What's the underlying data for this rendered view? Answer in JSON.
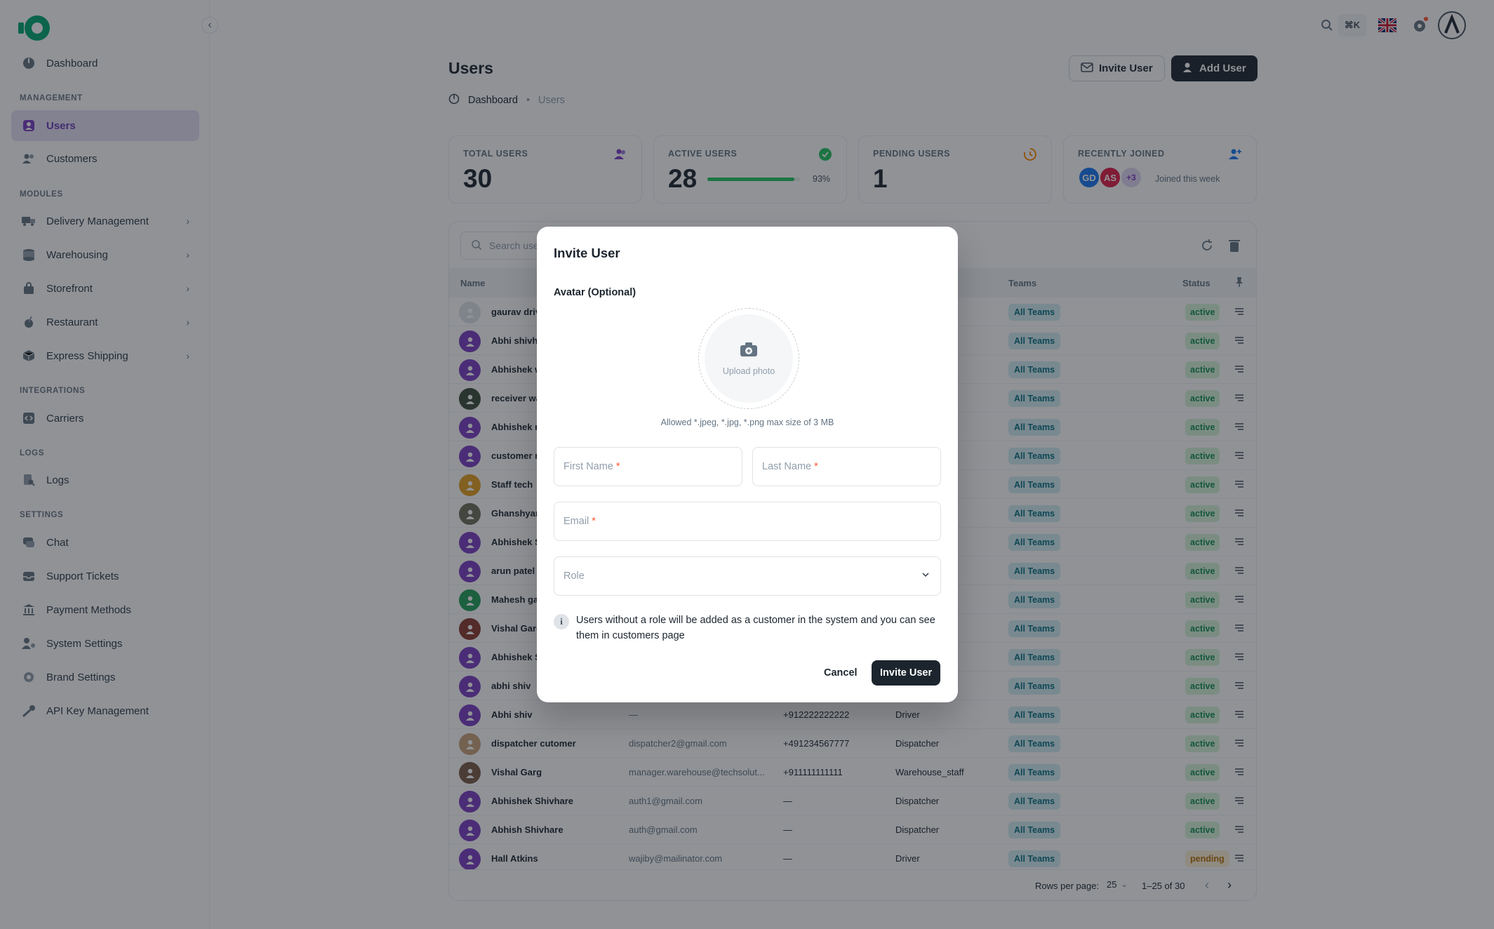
{
  "sidebar": {
    "collapse_icon": "chevron-left-icon",
    "items": {
      "dashboard": "Dashboard",
      "users": "Users",
      "customers": "Customers",
      "delivery": "Delivery Management",
      "warehousing": "Warehousing",
      "storefront": "Storefront",
      "restaurant": "Restaurant",
      "express": "Express Shipping",
      "carriers": "Carriers",
      "logs": "Logs",
      "chat": "Chat",
      "support": "Support Tickets",
      "payment": "Payment Methods",
      "system": "System Settings",
      "brand": "Brand Settings",
      "apikey": "API Key Management"
    },
    "sections": {
      "management": "MANAGEMENT",
      "modules": "MODULES",
      "integrations": "INTEGRATIONS",
      "logs": "LOGS",
      "settings": "SETTINGS"
    }
  },
  "topbar": {
    "shortcut": "⌘K"
  },
  "page": {
    "title": "Users",
    "invite_button": "Invite User",
    "add_button": "Add User",
    "breadcrumb": {
      "root": "Dashboard",
      "current": "Users"
    }
  },
  "stats": {
    "total": {
      "label": "TOTAL USERS",
      "value": "30"
    },
    "active": {
      "label": "ACTIVE USERS",
      "value": "28",
      "percent_text": "93%",
      "percent": 93
    },
    "pending": {
      "label": "PENDING USERS",
      "value": "1"
    },
    "recent": {
      "label": "RECENTLY JOINED",
      "avatars": [
        "GD",
        "AS",
        "+3"
      ],
      "note": "Joined this week"
    }
  },
  "table": {
    "search_placeholder": "Search users...",
    "headers": {
      "name": "Name",
      "teams": "Teams",
      "status": "Status"
    },
    "rows": [
      {
        "name": "gaurav driver",
        "email": "",
        "phone": "",
        "role": "",
        "team": "All Teams",
        "status": "active"
      },
      {
        "name": "Abhi shivhare",
        "email": "",
        "phone": "",
        "role": "",
        "team": "All Teams",
        "status": "active"
      },
      {
        "name": "Abhishek warehouse",
        "email": "",
        "phone": "",
        "role": "",
        "team": "All Teams",
        "status": "active"
      },
      {
        "name": "receiver warehouse",
        "email": "",
        "phone": "",
        "role": "",
        "team": "All Teams",
        "status": "active"
      },
      {
        "name": "Abhishek new",
        "email": "",
        "phone": "",
        "role": "",
        "team": "All Teams",
        "status": "active"
      },
      {
        "name": "customer new",
        "email": "",
        "phone": "",
        "role": "",
        "team": "All Teams",
        "status": "active"
      },
      {
        "name": "Staff tech",
        "email": "",
        "phone": "",
        "role": "",
        "team": "All Teams",
        "status": "active"
      },
      {
        "name": "Ghanshyam",
        "email": "",
        "phone": "",
        "role": "",
        "team": "All Teams",
        "status": "active"
      },
      {
        "name": "Abhishek Shivhare",
        "email": "",
        "phone": "",
        "role": "",
        "team": "All Teams",
        "status": "active"
      },
      {
        "name": "arun patel",
        "email": "",
        "phone": "",
        "role": "",
        "team": "All Teams",
        "status": "active"
      },
      {
        "name": "Mahesh gaur",
        "email": "",
        "phone": "",
        "role": "",
        "team": "All Teams",
        "status": "active"
      },
      {
        "name": "Vishal Garg",
        "email": "",
        "phone": "",
        "role": "",
        "team": "All Teams",
        "status": "active"
      },
      {
        "name": "Abhishek Shivhare",
        "email": "",
        "phone": "",
        "role": "",
        "team": "All Teams",
        "status": "active"
      },
      {
        "name": "abhi shiv",
        "email": "",
        "phone": "",
        "role": "",
        "team": "All Teams",
        "status": "active"
      },
      {
        "name": "Abhi shiv",
        "email": "—",
        "phone": "+912222222222",
        "role": "Driver",
        "team": "All Teams",
        "status": "active"
      },
      {
        "name": "dispatcher cutomer",
        "email": "dispatcher2@gmail.com",
        "phone": "+491234567777",
        "role": "Dispatcher",
        "team": "All Teams",
        "status": "active"
      },
      {
        "name": "Vishal Garg",
        "email": "manager.warehouse@techsolut...",
        "phone": "+911111111111",
        "role": "Warehouse_staff",
        "team": "All Teams",
        "status": "active"
      },
      {
        "name": "Abhishek Shivhare",
        "email": "auth1@gmail.com",
        "phone": "—",
        "role": "Dispatcher",
        "team": "All Teams",
        "status": "active"
      },
      {
        "name": "Abhish Shivhare",
        "email": "auth@gmail.com",
        "phone": "—",
        "role": "Dispatcher",
        "team": "All Teams",
        "status": "active"
      },
      {
        "name": "Hall Atkins",
        "email": "wajiby@mailinator.com",
        "phone": "—",
        "role": "Driver",
        "team": "All Teams",
        "status": "pending"
      }
    ],
    "footer": {
      "rows_per_page_label": "Rows per page:",
      "rows_per_page": "25",
      "range": "1–25 of 30"
    }
  },
  "modal": {
    "title": "Invite User",
    "avatar_label": "Avatar (Optional)",
    "upload_text": "Upload photo",
    "allowed_text": "Allowed *.jpeg, *.jpg, *.png max size of 3 MB",
    "first_name_placeholder": "First Name",
    "last_name_placeholder": "Last Name",
    "email_placeholder": "Email",
    "required_mark": "*",
    "role_placeholder": "Role",
    "info_text": "Users without a role will be added as a customer in the system and you can see them in customers page",
    "cancel_label": "Cancel",
    "submit_label": "Invite User"
  },
  "colors": {
    "primary_dark": "#1c252e",
    "accent_purple": "#7b3fc4",
    "success": "#22c55e",
    "overlay": "rgba(22,28,36,0.48)"
  }
}
